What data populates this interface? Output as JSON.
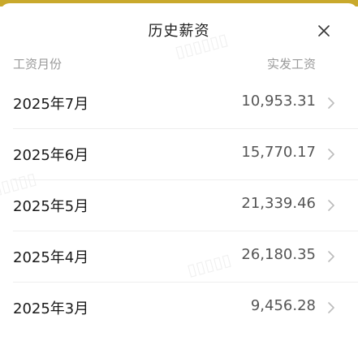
{
  "header": {
    "title": "历史薪资"
  },
  "columns": {
    "left": "工资月份",
    "right": "实发工资"
  },
  "rows": [
    {
      "month": "2025年7月",
      "amount": "10,953.31"
    },
    {
      "month": "2025年6月",
      "amount": "15,770.17"
    },
    {
      "month": "2025年5月",
      "amount": "21,339.46"
    },
    {
      "month": "2025年4月",
      "amount": "26,180.35"
    },
    {
      "month": "2025年3月",
      "amount": "9,456.28"
    }
  ],
  "icons": {
    "close": "close-icon",
    "chevron": "chevron-right-icon"
  },
  "colors": {
    "accent_strip": "#c9a92c",
    "header_text": "#9a9a9a"
  }
}
